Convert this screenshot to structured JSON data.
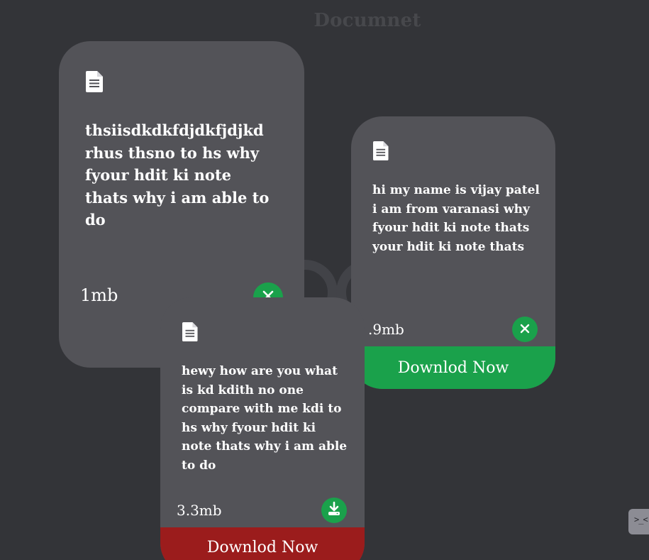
{
  "page": {
    "title": "Documnet"
  },
  "cards": [
    {
      "text": "thsiisdkdkfdjdkfjdjkd rhus thsno to hs why fyour hdit ki note thats why i am able to do",
      "size": "1mb",
      "action_icon": "close-icon"
    },
    {
      "text": "hi my name is vijay patel i am from varanasi why fyour hdit ki note thats your hdit ki note thats",
      "size": ".9mb",
      "action_icon": "close-icon",
      "download_label": "Downlod Now",
      "download_color": "#1aa14b"
    },
    {
      "text": "hewy how are you what is kd kdith no one compare with me kdi to hs why fyour hdit ki note thats why i am able to do",
      "size": "3.3mb",
      "action_icon": "download-icon",
      "download_label": "Downlod Now",
      "download_color": "#9b1c1c"
    }
  ],
  "colors": {
    "background": "#333438",
    "card": "#535358",
    "accent_green": "#1aa14b",
    "accent_red": "#9b1c1c"
  },
  "terminal_button": {
    "icon": "terminal-face-icon",
    "glyph": ">_<"
  }
}
